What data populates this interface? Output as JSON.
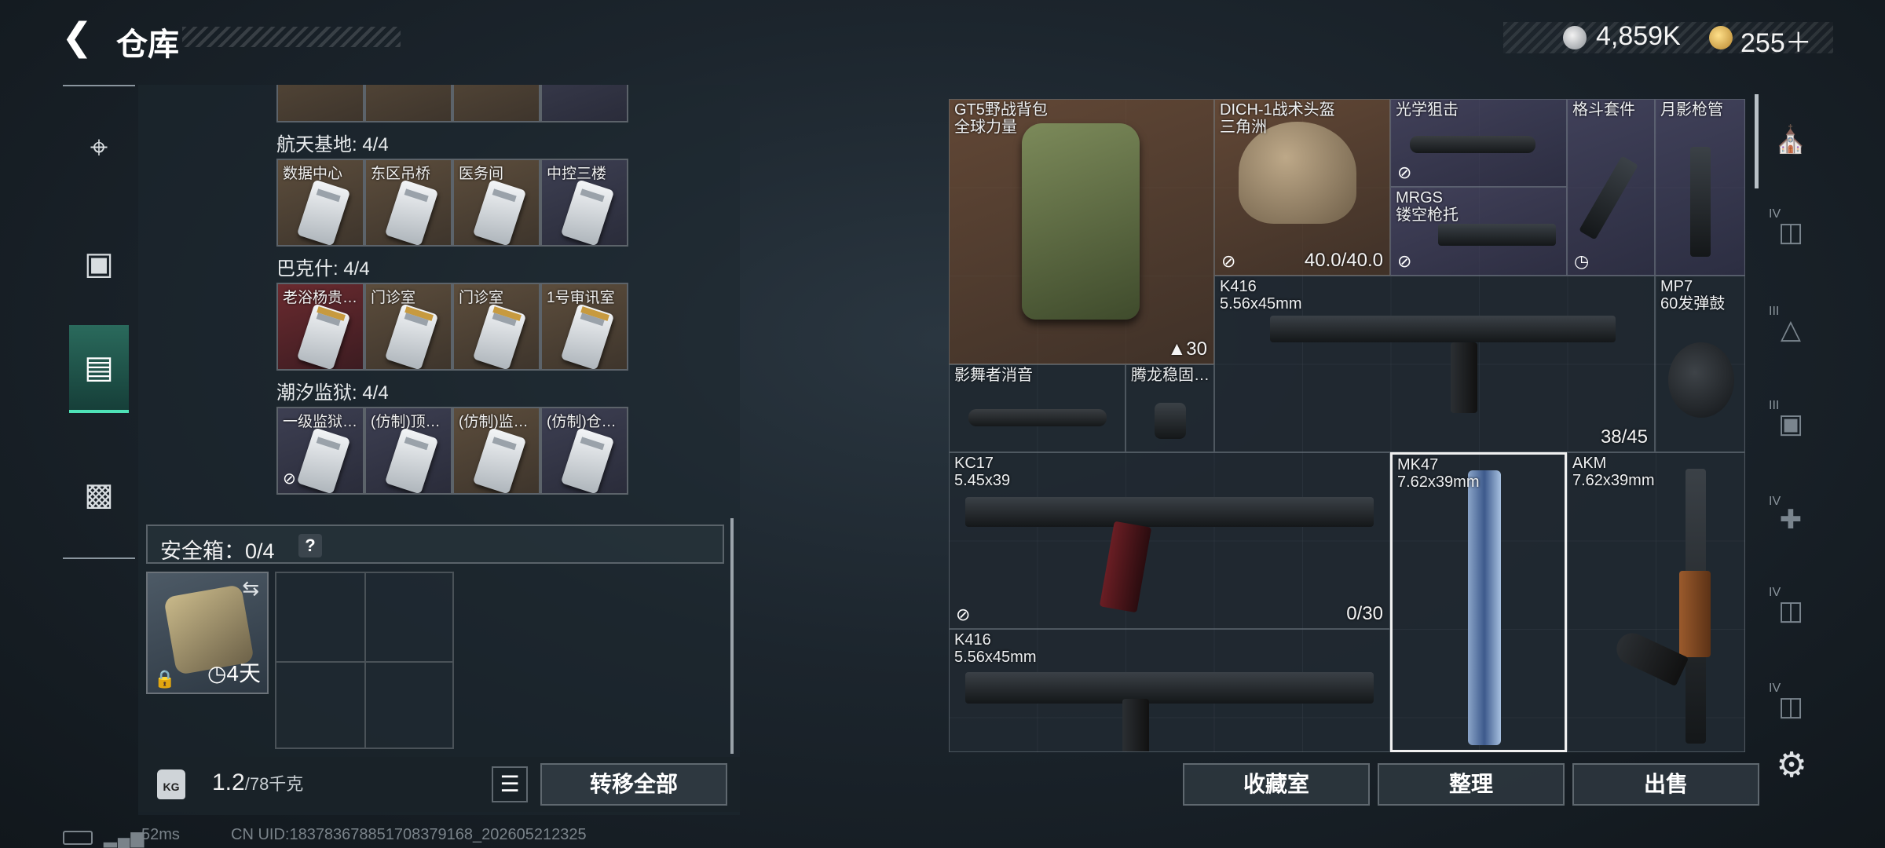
{
  "header": {
    "title": "仓库",
    "silver": "4,859K",
    "gold": "255＋"
  },
  "nav": [
    {
      "icon": "rifle-icon"
    },
    {
      "icon": "backpack-icon"
    },
    {
      "icon": "container-icon",
      "active": true
    },
    {
      "icon": "briefcase-icon"
    }
  ],
  "stash": {
    "sections": [
      {
        "title": "航天基地: 4/4",
        "cards": [
          {
            "label": "数据中心",
            "tone": "tan"
          },
          {
            "label": "东区吊桥",
            "tone": "tan"
          },
          {
            "label": "医务间",
            "tone": "tan"
          },
          {
            "label": "中控三楼",
            "tone": "blue"
          }
        ]
      },
      {
        "title": "巴克什: 4/4",
        "cards": [
          {
            "label": "老浴杨贵…",
            "tone": "red"
          },
          {
            "label": "门诊室",
            "tone": "tan"
          },
          {
            "label": "门诊室",
            "tone": "tan"
          },
          {
            "label": "1号审讯室",
            "tone": "tan"
          }
        ]
      },
      {
        "title": "潮汐监狱: 4/4",
        "cards": [
          {
            "label": "一级监狱…",
            "tone": "blue"
          },
          {
            "label": "(仿制)顶…",
            "tone": "blue"
          },
          {
            "label": "(仿制)监…",
            "tone": "tan"
          },
          {
            "label": "(仿制)仓…",
            "tone": "blue"
          }
        ]
      }
    ],
    "safe_label": "安全箱：0/4",
    "safe_help": "?",
    "safe_item_time": "4天",
    "weight": "1.2",
    "weight_max": "/78千克",
    "transfer_all": "转移全部"
  },
  "status": {
    "ping": "52ms",
    "uid": "CN UID:183783678851708379168_202605212325"
  },
  "inventory": {
    "items": [
      {
        "name": "GT5野战背包",
        "sub": "全球力量",
        "count": "30"
      },
      {
        "name": "DICH-1战术头盔",
        "sub": "三角洲",
        "count": "40.0/40.0"
      },
      {
        "name": "光学狙击",
        "sub": ""
      },
      {
        "name": "MRGS",
        "sub": "镂空枪托"
      },
      {
        "name": "格斗套件",
        "sub": ""
      },
      {
        "name": "月影枪管",
        "sub": ""
      },
      {
        "name": "K416",
        "sub": "5.56x45mm",
        "count": "38/45"
      },
      {
        "name": "MP7",
        "sub": "60发弹鼓"
      },
      {
        "name": "影舞者消音",
        "sub": ""
      },
      {
        "name": "腾龙稳固…",
        "sub": ""
      },
      {
        "name": "KC17",
        "sub": "5.45x39",
        "count": "0/30"
      },
      {
        "name": "MK47",
        "sub": "7.62x39mm"
      },
      {
        "name": "AKM",
        "sub": "7.62x39mm"
      },
      {
        "name": "K416",
        "sub": "5.56x45mm"
      }
    ],
    "actions": [
      "收藏室",
      "整理",
      "出售"
    ]
  },
  "side_tabs": [
    "",
    "IV",
    "III",
    "III",
    "IV",
    "IV",
    "IV"
  ],
  "colors": {
    "accent": "#4ee2b7",
    "panel": "#1c252d"
  }
}
